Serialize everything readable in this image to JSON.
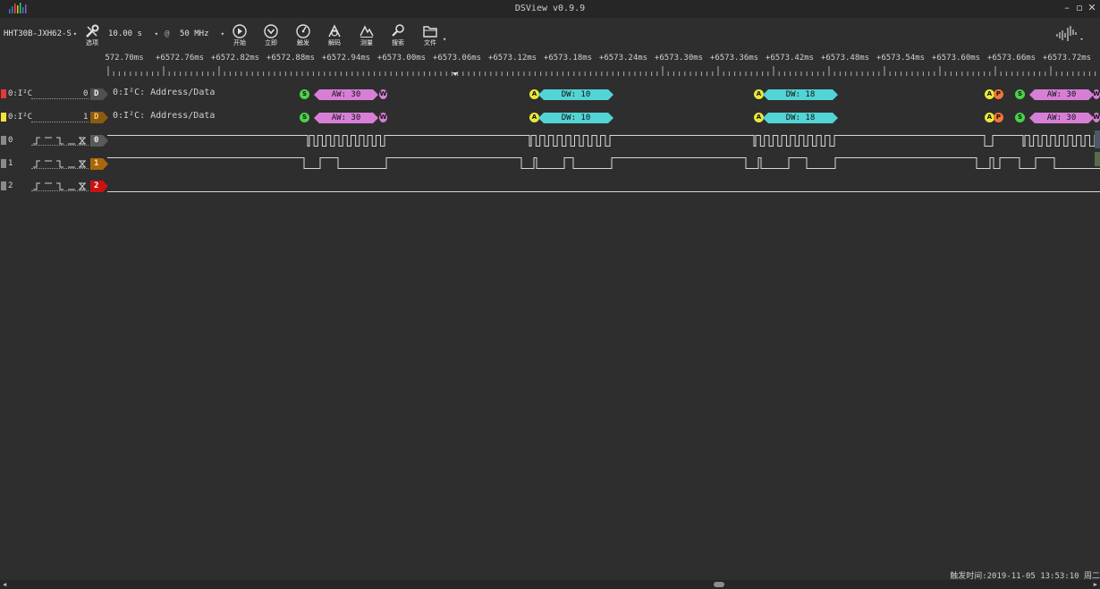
{
  "window": {
    "title": "DSView v0.9.9",
    "min_icon": "minimize-icon",
    "max_icon": "maximize-icon",
    "close_icon": "close-icon"
  },
  "toolbar": {
    "device": "HHT30B-JXH62-S",
    "sample_time": "10.00 s",
    "at": "@",
    "sample_rate": "50 MHz",
    "buttons": {
      "options": "选项",
      "start": "开始",
      "instant": "立即",
      "trigger": "触发",
      "decode": "解码",
      "measure": "测量",
      "search": "搜索",
      "file": "文件"
    }
  },
  "ruler": {
    "labels": [
      "572.70ms",
      "+6572.76ms",
      "+6572.82ms",
      "+6572.88ms",
      "+6572.94ms",
      "+6573.00ms",
      "+6573.06ms",
      "+6573.12ms",
      "+6573.18ms",
      "+6573.24ms",
      "+6573.30ms",
      "+6573.36ms",
      "+6573.42ms",
      "+6573.48ms",
      "+6573.54ms",
      "+6573.60ms",
      "+6573.66ms",
      "+6573.72ms"
    ]
  },
  "channels": [
    {
      "name": "0:I²C",
      "index": "0",
      "badge": "D",
      "color": "#e53935",
      "decoder_title": "0:I²C: Address/Data"
    },
    {
      "name": "0:I²C",
      "index": "1",
      "badge": "D",
      "color": "#f5e23c",
      "decoder_title": "0:I²C: Address/Data"
    },
    {
      "name": "0",
      "badge": "0",
      "color": "#8a8a8a"
    },
    {
      "name": "1",
      "badge": "1",
      "color": "#8a8a8a"
    },
    {
      "name": "2",
      "badge": "2",
      "color": "#8a8a8a"
    }
  ],
  "annotations": {
    "start": "S",
    "ack": "A",
    "write": "W",
    "stop": "P",
    "aw1": "AW: 30",
    "dw1": "DW: 10",
    "dw2": "DW: 18",
    "aw2": "AW: 30"
  },
  "colors": {
    "address": "#d77fd7",
    "data": "#53d4d4",
    "start": "#4ad34a",
    "ack": "#e8e83a",
    "stop": "#f2753a",
    "background": "#2e2e2e",
    "badge_i2c_0": "#505050",
    "badge_i2c_1": "#8c5a0e",
    "badge_ch1": "#a9670b",
    "badge_ch2": "#cc1111"
  },
  "status": {
    "trigger_time": "触发时间:2019-11-05 13:53:10 周二"
  }
}
